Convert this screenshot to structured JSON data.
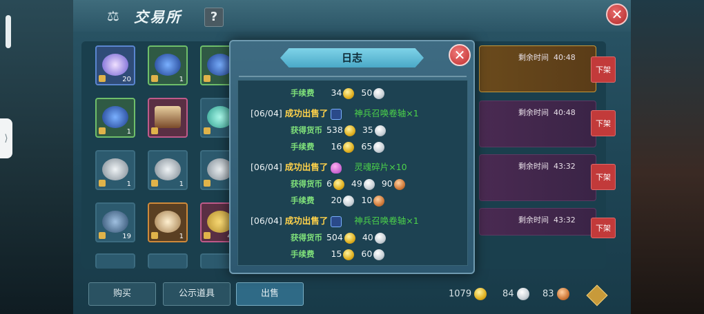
{
  "window": {
    "title": "交易所",
    "help_label": "?",
    "close_label": "✕"
  },
  "listings": [
    {
      "time_label": "剩余时间",
      "time": "40:48",
      "off_label": "下架"
    },
    {
      "time_label": "剩余时间",
      "time": "40:48",
      "off_label": "下架"
    },
    {
      "time_label": "剩余时间",
      "time": "43:32",
      "off_label": "下架"
    },
    {
      "time_label": "剩余时间",
      "time": "43:32",
      "off_label": "下架"
    }
  ],
  "slots": [
    {
      "count": "20"
    },
    {
      "count": "1"
    },
    {
      "count": ""
    },
    {
      "count": "1"
    },
    {
      "count": ""
    },
    {
      "count": ""
    },
    {
      "count": "1"
    },
    {
      "count": "1"
    },
    {
      "count": ""
    },
    {
      "count": "19"
    },
    {
      "count": "1"
    },
    {
      "count": "41"
    }
  ],
  "tabs": {
    "buy": "购买",
    "public": "公示道具",
    "sell": "出售"
  },
  "wallet": {
    "gold": "1079",
    "silver": "84",
    "bronze": "83"
  },
  "log": {
    "title": "日志",
    "close_label": "✕",
    "entries": [
      {
        "fee_label": "手续费",
        "fee_gold": "34",
        "fee_silver": "50"
      },
      {
        "date": "[06/04]",
        "sold_label": "成功出售了",
        "item": "神兵召唤卷轴×1",
        "earn_label": "获得货币",
        "earn_gold": "538",
        "earn_silver": "35",
        "fee_label": "手续费",
        "fee_gold": "16",
        "fee_silver": "65"
      },
      {
        "date": "[06/04]",
        "sold_label": "成功出售了",
        "item": "灵魂碎片×10",
        "earn_label": "获得货币",
        "earn_gold": "6",
        "earn_silver": "49",
        "earn_bronze": "90",
        "fee_label": "手续费",
        "fee_gold": "20",
        "fee_silver": "10"
      },
      {
        "date": "[06/04]",
        "sold_label": "成功出售了",
        "item": "神兵召唤卷轴×1",
        "earn_label": "获得货币",
        "earn_gold": "504",
        "earn_silver": "40",
        "fee_label": "手续费",
        "fee_gold": "15",
        "fee_silver": "60"
      }
    ]
  },
  "side": {
    "toggle_label": "⟩"
  }
}
